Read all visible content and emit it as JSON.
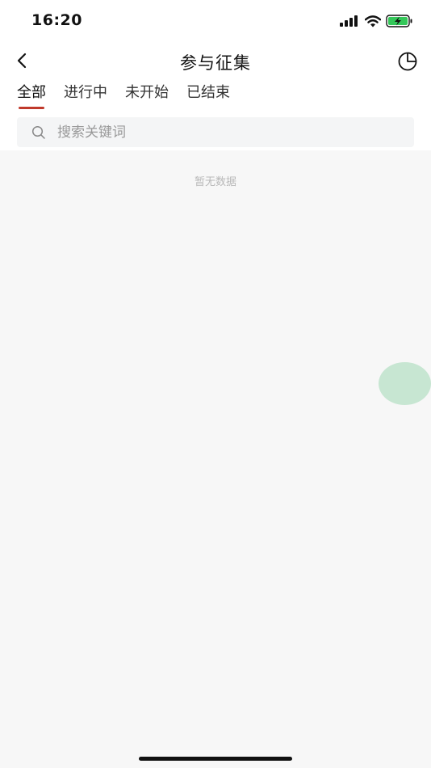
{
  "status_bar": {
    "time": "16:20"
  },
  "header": {
    "title": "参与征集"
  },
  "tabs": [
    {
      "label": "全部",
      "active": true
    },
    {
      "label": "进行中",
      "active": false
    },
    {
      "label": "未开始",
      "active": false
    },
    {
      "label": "已结束",
      "active": false
    }
  ],
  "search": {
    "placeholder": "搜索关键词",
    "value": ""
  },
  "content": {
    "empty_text": "暂无数据"
  },
  "icons": {
    "back": "chevron-left-icon",
    "stats": "pie-chart-icon",
    "search": "search-icon"
  },
  "colors": {
    "accent": "#c0392b",
    "battery": "#34c759",
    "floating_button": "#c7e6d2",
    "content_background": "#f7f7f7"
  }
}
